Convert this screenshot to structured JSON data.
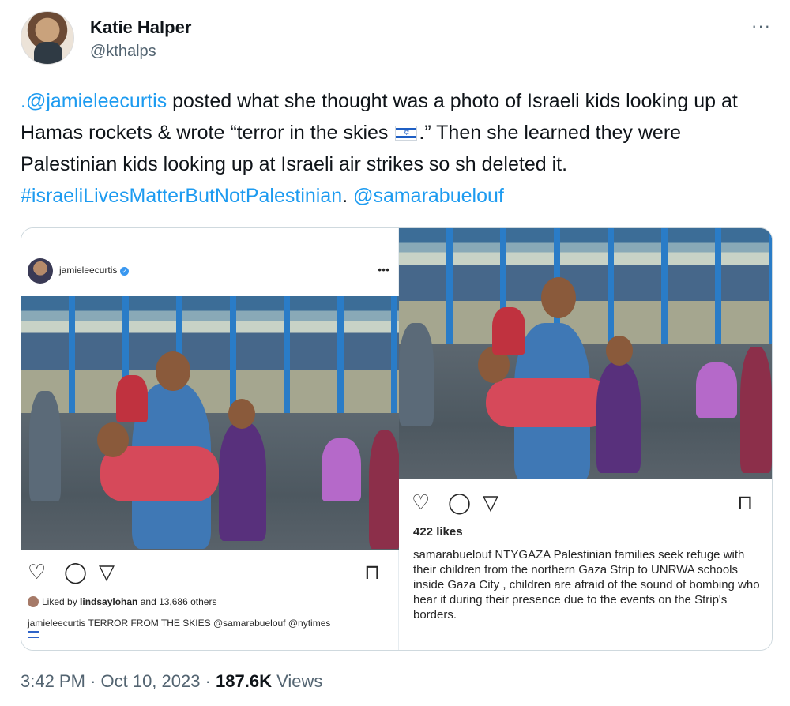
{
  "author": {
    "name": "Katie Halper",
    "handle": "@kthalps"
  },
  "more_glyph": "···",
  "tweet": {
    "mention1": ".@jamieleecurtis",
    "text1": " posted what she thought was a photo of Israeli kids looking up at Hamas rockets & wrote “terror in the skies ",
    "text2": ".” Then she learned they were Palestinian kids looking up at Israeli air strikes so sh deleted it. ",
    "hashtag": "#israeliLivesMatterButNotPalestinian",
    "text3": ". ",
    "mention2": "@samarabuelouf"
  },
  "left_post": {
    "username": "jamieleecurtis",
    "more_glyph": "•••",
    "liked_by_prefix": "Liked by ",
    "liked_by_user": "lindsaylohan",
    "liked_by_suffix": " and 13,686 others",
    "caption_user": "jamieleecurtis",
    "caption_text": " TERROR FROM THE SKIES @samarabuelouf @nytimes"
  },
  "right_post": {
    "likes": "422 likes",
    "caption_user": "samarabuelouf",
    "caption_text": " NTYGAZA Palestinian families seek refuge with their children from the northern Gaza Strip to UNRWA schools inside Gaza City , children are afraid of the sound of bombing who hear it during their presence due to the events on the Strip's borders."
  },
  "icons": {
    "heart": "♡",
    "comment": "◯",
    "share": "▽",
    "bookmark": "⊓"
  },
  "footer": {
    "time": "3:42 PM",
    "sep": " · ",
    "date": "Oct 10, 2023",
    "views_count": "187.6K",
    "views_label": " Views"
  }
}
